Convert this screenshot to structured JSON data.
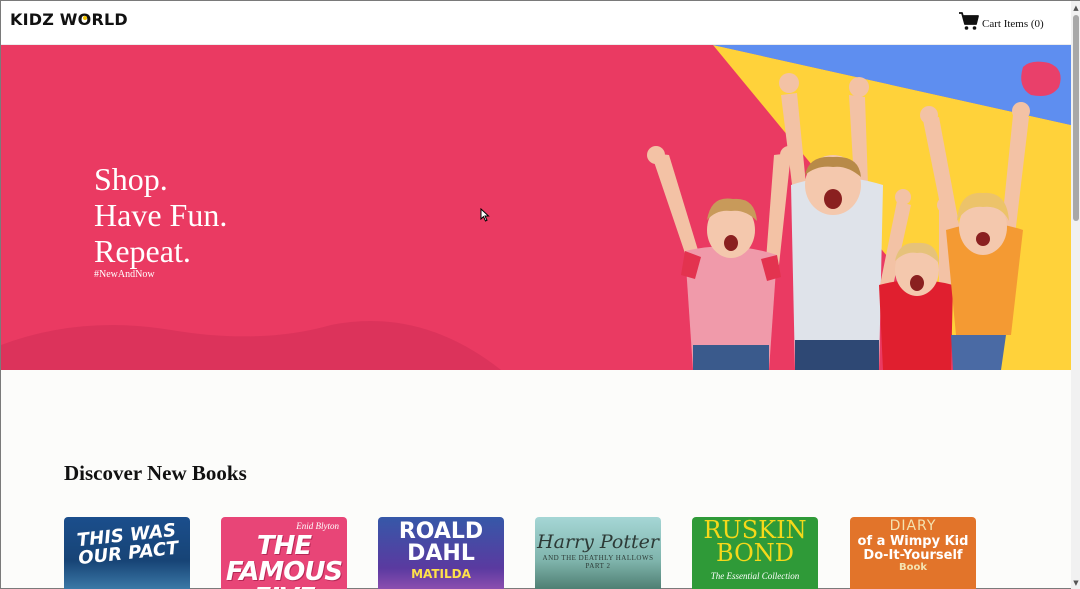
{
  "header": {
    "logo_text_before": "KIDZ W",
    "logo_text_o": "O",
    "logo_text_after": "RLD",
    "cart_label": "Cart Items (0)",
    "cart_icon": "shopping-cart-icon"
  },
  "hero": {
    "line1": "Shop.",
    "line2": "Have Fun.",
    "line3": "Repeat.",
    "tag": "#NewAndNow",
    "colors": {
      "pink": "#ea3a62",
      "yellow": "#ffd23a",
      "blue": "#5e8ef0"
    }
  },
  "section": {
    "title": "Discover New Books"
  },
  "books": [
    {
      "title": "THIS WAS OUR PACT"
    },
    {
      "author": "Enid Blyton",
      "title": "THE FAMOUS FIVE"
    },
    {
      "title": "ROALD DAHL",
      "subtitle": "MATILDA"
    },
    {
      "title": "Harry Potter",
      "subtitle": "AND THE DEATHLY HALLOWS PART 2"
    },
    {
      "title": "RUSKIN BOND",
      "subtitle": "The Essential Collection"
    },
    {
      "title": "DIARY",
      "subtitle": "of a Wimpy Kid Do-It-Yourself",
      "subtitle2": "Book"
    }
  ]
}
